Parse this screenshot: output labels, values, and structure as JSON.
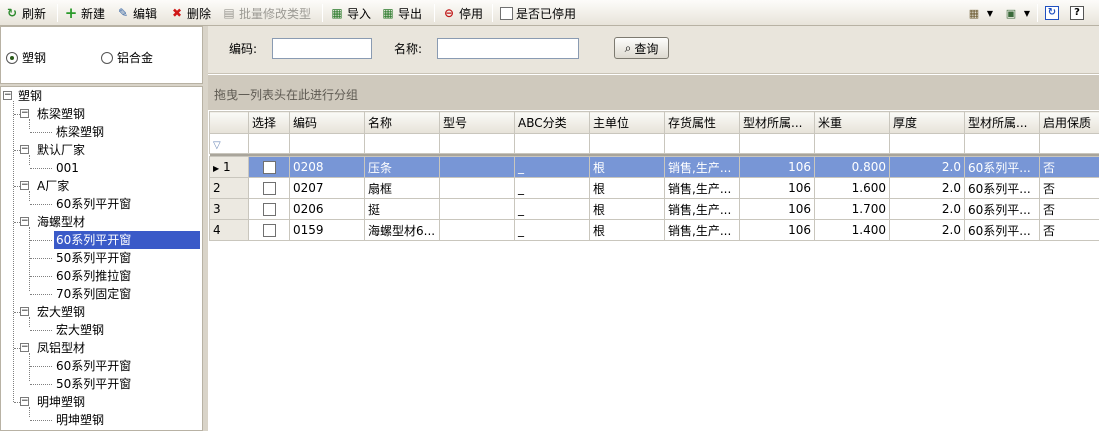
{
  "toolbar": {
    "refresh": "刷新",
    "new": "新建",
    "edit": "编辑",
    "delete": "删除",
    "batch_modify": "批量修改类型",
    "import": "导入",
    "export": "导出",
    "disable": "停用",
    "show_disabled": "是否已停用",
    "help": "?"
  },
  "material_type": {
    "option1": "塑钢",
    "option2": "铝合金",
    "selected": "塑钢"
  },
  "tree": {
    "root": "塑钢",
    "n1": "栋梁塑钢",
    "n1c1": "栋梁塑钢",
    "n2": "默认厂家",
    "n2c1": "001",
    "n3": "A厂家",
    "n3c1": "60系列平开窗",
    "n4": "海螺型材",
    "n4c1": "60系列平开窗",
    "n4c2": "50系列平开窗",
    "n4c3": "60系列推拉窗",
    "n4c4": "70系列固定窗",
    "n5": "宏大塑钢",
    "n5c1": "宏大塑钢",
    "n6": "凤铝型材",
    "n6c1": "60系列平开窗",
    "n6c2": "50系列平开窗",
    "n7": "明坤塑钢",
    "n7c1": "明坤塑钢"
  },
  "search": {
    "code_label": "编码:",
    "code_value": "",
    "name_label": "名称:",
    "name_value": "",
    "query_button": "查询"
  },
  "grid": {
    "group_hint": "拖曳一列表头在此进行分组",
    "columns": [
      "选择",
      "编码",
      "名称",
      "型号",
      "ABC分类",
      "主单位",
      "存货属性",
      "型材所属...",
      "米重",
      "厚度",
      "型材所属...",
      "启用保质"
    ],
    "rows": [
      {
        "idx": "1",
        "code": "0208",
        "name": "压条",
        "model": "",
        "abc": "_",
        "unit": "根",
        "attr": "销售,生产...",
        "belong": "106",
        "weight": "0.800",
        "thick": "2.0",
        "series": "60系列平...",
        "shelf": "否"
      },
      {
        "idx": "2",
        "code": "0207",
        "name": "扇框",
        "model": "",
        "abc": "_",
        "unit": "根",
        "attr": "销售,生产...",
        "belong": "106",
        "weight": "1.600",
        "thick": "2.0",
        "series": "60系列平...",
        "shelf": "否"
      },
      {
        "idx": "3",
        "code": "0206",
        "name": "挺",
        "model": "",
        "abc": "_",
        "unit": "根",
        "attr": "销售,生产...",
        "belong": "106",
        "weight": "1.700",
        "thick": "2.0",
        "series": "60系列平...",
        "shelf": "否"
      },
      {
        "idx": "4",
        "code": "0159",
        "name": "海螺型材6...",
        "model": "",
        "abc": "_",
        "unit": "根",
        "attr": "销售,生产...",
        "belong": "106",
        "weight": "1.400",
        "thick": "2.0",
        "series": "60系列平...",
        "shelf": "否"
      }
    ]
  },
  "colors": {
    "accent": "#3a5ac8",
    "row_selected": "#7896d6",
    "group_bar": "#cfc9bd"
  }
}
